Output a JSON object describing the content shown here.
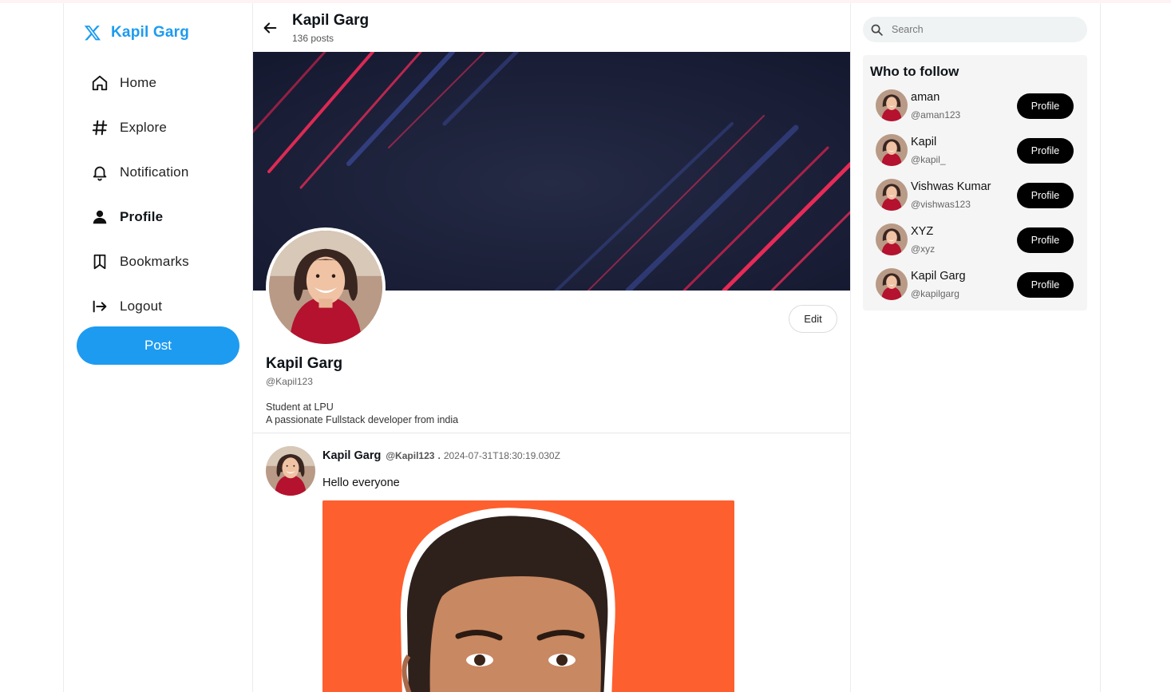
{
  "brand": {
    "name": "Kapil Garg",
    "icon": "x-logo-icon"
  },
  "nav": {
    "items": [
      {
        "label": "Home",
        "icon": "home-icon"
      },
      {
        "label": "Explore",
        "icon": "hashtag-icon"
      },
      {
        "label": "Notification",
        "icon": "bell-icon"
      },
      {
        "label": "Profile",
        "icon": "person-icon",
        "active": true
      },
      {
        "label": "Bookmarks",
        "icon": "bookmark-icon"
      },
      {
        "label": "Logout",
        "icon": "logout-icon"
      }
    ],
    "post_label": "Post"
  },
  "header": {
    "title": "Kapil Garg",
    "posts_count": "136 posts"
  },
  "profile": {
    "name": "Kapil Garg",
    "handle": "@Kapil123",
    "bio_line1": "Student at LPU",
    "bio_line2": "A passionate Fullstack developer from india",
    "edit_label": "Edit"
  },
  "tweet": {
    "author": "Kapil Garg",
    "handle": "@Kapil123",
    "separator": ".",
    "timestamp": "2024-07-31T18:30:19.030Z",
    "text": "Hello everyone"
  },
  "search": {
    "placeholder": "Search"
  },
  "who_to_follow": {
    "title": "Who to follow",
    "button_label": "Profile",
    "users": [
      {
        "name": "aman",
        "handle": "@aman123"
      },
      {
        "name": "Kapil",
        "handle": "@kapil_"
      },
      {
        "name": "Vishwas Kumar",
        "handle": "@vishwas123"
      },
      {
        "name": "XYZ",
        "handle": "@xyz"
      },
      {
        "name": "Kapil Garg",
        "handle": "@kapilgarg"
      }
    ]
  },
  "colors": {
    "accent": "#1d9bf0",
    "cover": "#1b1f38",
    "tweet_image_bg": "#fe5f2f"
  }
}
